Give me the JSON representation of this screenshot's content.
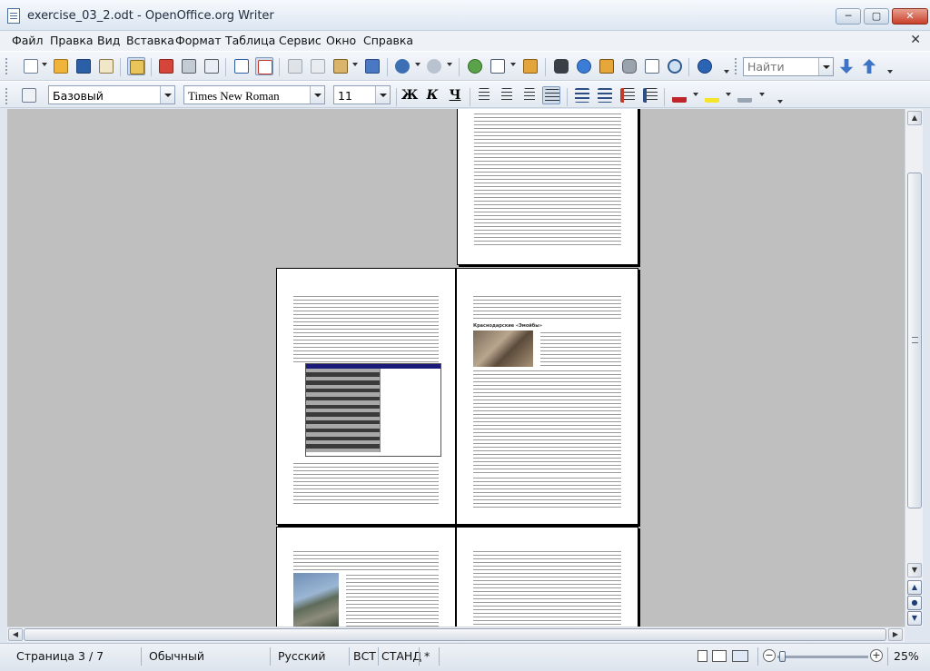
{
  "window": {
    "title": "exercise_03_2.odt - OpenOffice.org Writer",
    "minimize": "─",
    "maximize": "▢",
    "close": "✕"
  },
  "menu": {
    "items": [
      "Файл",
      "Правка",
      "Вид",
      "Вставка",
      "Формат",
      "Таблица",
      "Сервис",
      "Окно",
      "Справка"
    ],
    "close_doc": "✕"
  },
  "toolbar": {
    "find_placeholder": "Найти"
  },
  "format_toolbar": {
    "style": "Базовый",
    "font": "Times New Roman",
    "size": "11",
    "bold": "Ж",
    "italic": "К",
    "underline": "Ч"
  },
  "document": {
    "section_heading": "Краснодарские «Эмойбы»"
  },
  "status": {
    "page": "Страница  3 / 7",
    "style": "Обычный",
    "language": "Русский",
    "insert": "ВСТ",
    "selection": "СТАНД",
    "modified": "*",
    "zoom": "25%"
  },
  "colors": {
    "table_header": "#1a1a7a",
    "canvas": "#bfbfbf"
  }
}
